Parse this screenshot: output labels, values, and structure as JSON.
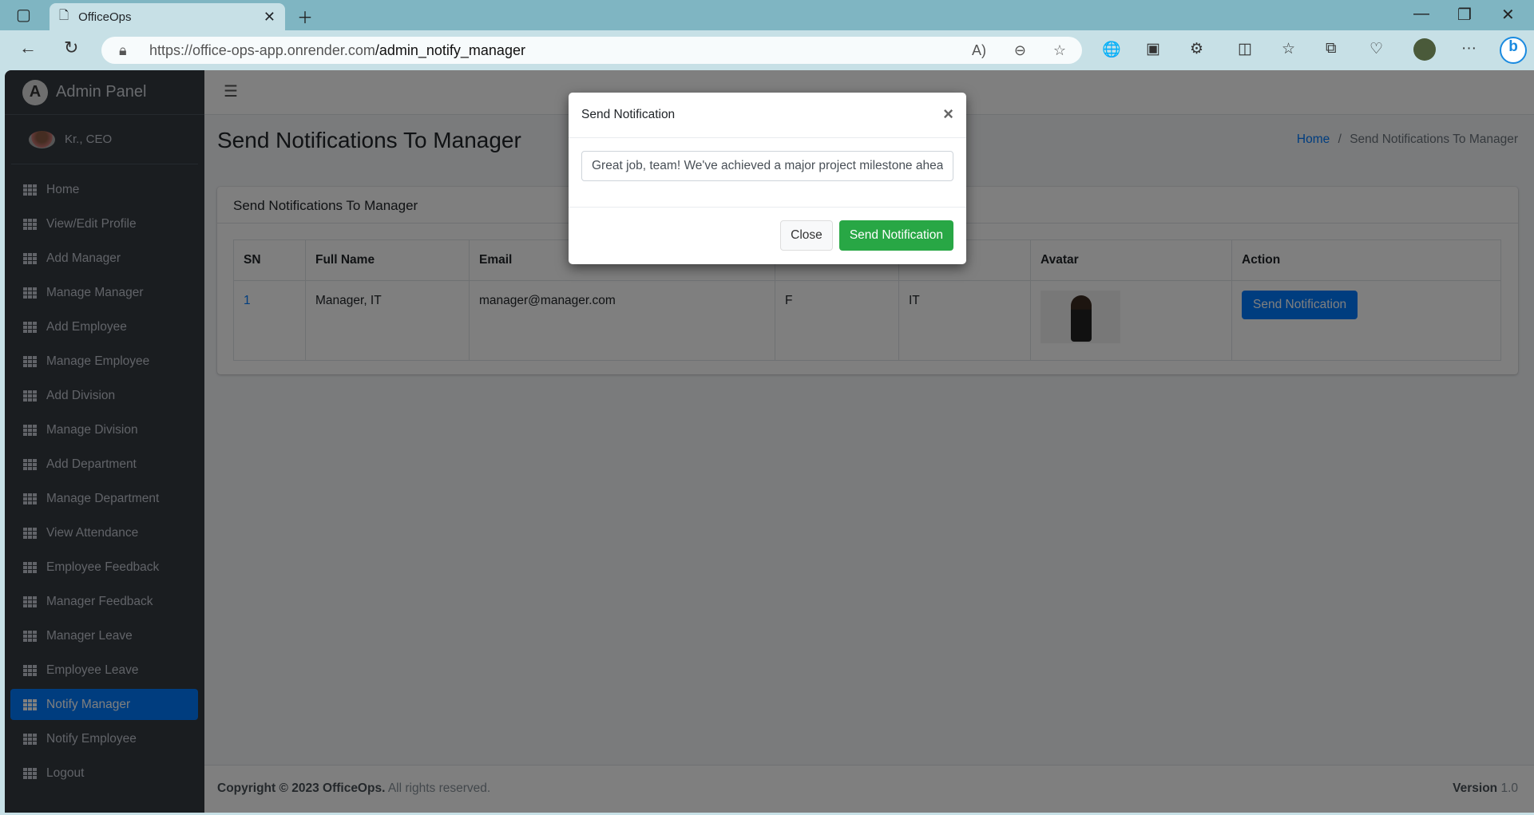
{
  "browser": {
    "tab_title": "OfficeOps",
    "url_host": "https://office-ops-app.onrender.com",
    "url_path": "/admin_notify_manager"
  },
  "sidebar": {
    "brand": "Admin Panel",
    "user": "Kr., CEO",
    "items": [
      {
        "label": "Home"
      },
      {
        "label": "View/Edit Profile"
      },
      {
        "label": "Add Manager"
      },
      {
        "label": "Manage Manager"
      },
      {
        "label": "Add Employee"
      },
      {
        "label": "Manage Employee"
      },
      {
        "label": "Add Division"
      },
      {
        "label": "Manage Division"
      },
      {
        "label": "Add Department"
      },
      {
        "label": "Manage Department"
      },
      {
        "label": "View Attendance"
      },
      {
        "label": "Employee Feedback"
      },
      {
        "label": "Manager Feedback"
      },
      {
        "label": "Manager Leave"
      },
      {
        "label": "Employee Leave"
      },
      {
        "label": "Notify Manager",
        "active": true
      },
      {
        "label": "Notify Employee"
      },
      {
        "label": "Logout"
      }
    ]
  },
  "header": {
    "title": "Send Notifications To Manager",
    "breadcrumb": {
      "home": "Home",
      "sep": "/",
      "current": "Send Notifications To Manager"
    }
  },
  "card": {
    "title": "Send Notifications To Manager",
    "columns": [
      "SN",
      "Full Name",
      "Email",
      "",
      "",
      "Avatar",
      "Action"
    ],
    "rows": [
      {
        "sn": "1",
        "name": "Manager, IT",
        "email": "manager@manager.com",
        "gender": "F",
        "department": "IT",
        "action": "Send Notification"
      }
    ]
  },
  "footer": {
    "copyright": "Copyright © 2023 OfficeOps.",
    "rights": " All rights reserved.",
    "version_label": "Version",
    "version": " 1.0"
  },
  "modal": {
    "title": "Send Notification",
    "message": "Great job, team! We've achieved a major project milestone ahead of",
    "close": "Close",
    "send": "Send Notification"
  },
  "colors": {
    "primary": "#007bff",
    "success": "#28a745",
    "sidebar": "#343a40"
  }
}
